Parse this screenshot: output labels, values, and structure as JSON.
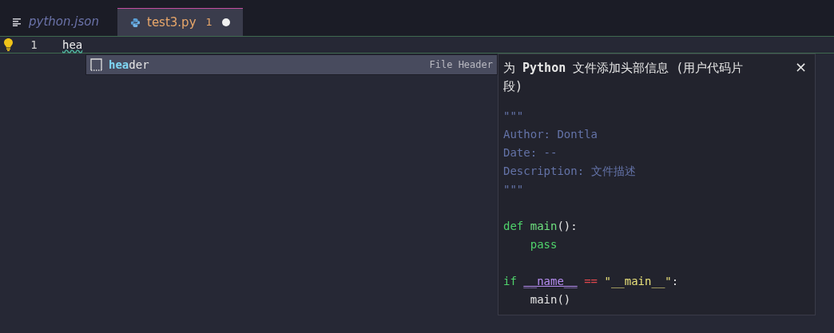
{
  "tabs": [
    {
      "label": "python.json",
      "kind": "lines",
      "selected": false,
      "preview": true,
      "modified": false
    },
    {
      "label": "test3.py",
      "kind": "python",
      "selected": true,
      "preview": false,
      "problems": "1",
      "modified": true
    }
  ],
  "editor": {
    "line_number": "1",
    "typed": "hea",
    "lightbulb": true
  },
  "suggestion": {
    "label": "**hea**der",
    "detail": "File Header",
    "selected": true
  },
  "details": {
    "title": "为 **Python** 文件添加头部信息 (用户代码片段)",
    "close": "×",
    "code": [
      {
        "kind": "code",
        "tokens": [
          {
            "kind": "comment",
            "text": "\"\"\""
          }
        ]
      },
      {
        "kind": "code",
        "tokens": [
          {
            "kind": "comment",
            "text": "Author: Dontla"
          }
        ]
      },
      {
        "kind": "code",
        "tokens": [
          {
            "kind": "comment",
            "text": "Date: --"
          }
        ]
      },
      {
        "kind": "code",
        "tokens": [
          {
            "kind": "comment",
            "text": "Description: 文件描述"
          }
        ]
      },
      {
        "kind": "code",
        "tokens": [
          {
            "kind": "comment",
            "text": "\"\"\""
          }
        ]
      },
      {
        "kind": "blank"
      },
      {
        "kind": "code",
        "tokens": [
          {
            "kind": "keyword",
            "text": "def "
          },
          {
            "kind": "function",
            "text": "main"
          },
          {
            "kind": "plain",
            "text": "():"
          }
        ]
      },
      {
        "kind": "code",
        "tokens": [
          {
            "kind": "keyword",
            "text": "    pass"
          }
        ]
      },
      {
        "kind": "blank"
      },
      {
        "kind": "code",
        "tokens": [
          {
            "kind": "keyword",
            "text": "if "
          },
          {
            "kind": "builtin",
            "text": "__name__"
          },
          {
            "kind": "operator",
            "text": " == "
          },
          {
            "kind": "string",
            "text": "\"__main__\""
          },
          {
            "kind": "plain",
            "text": ":"
          }
        ]
      },
      {
        "kind": "code",
        "tokens": [
          {
            "kind": "plain",
            "text": "    main()"
          }
        ]
      }
    ]
  }
}
